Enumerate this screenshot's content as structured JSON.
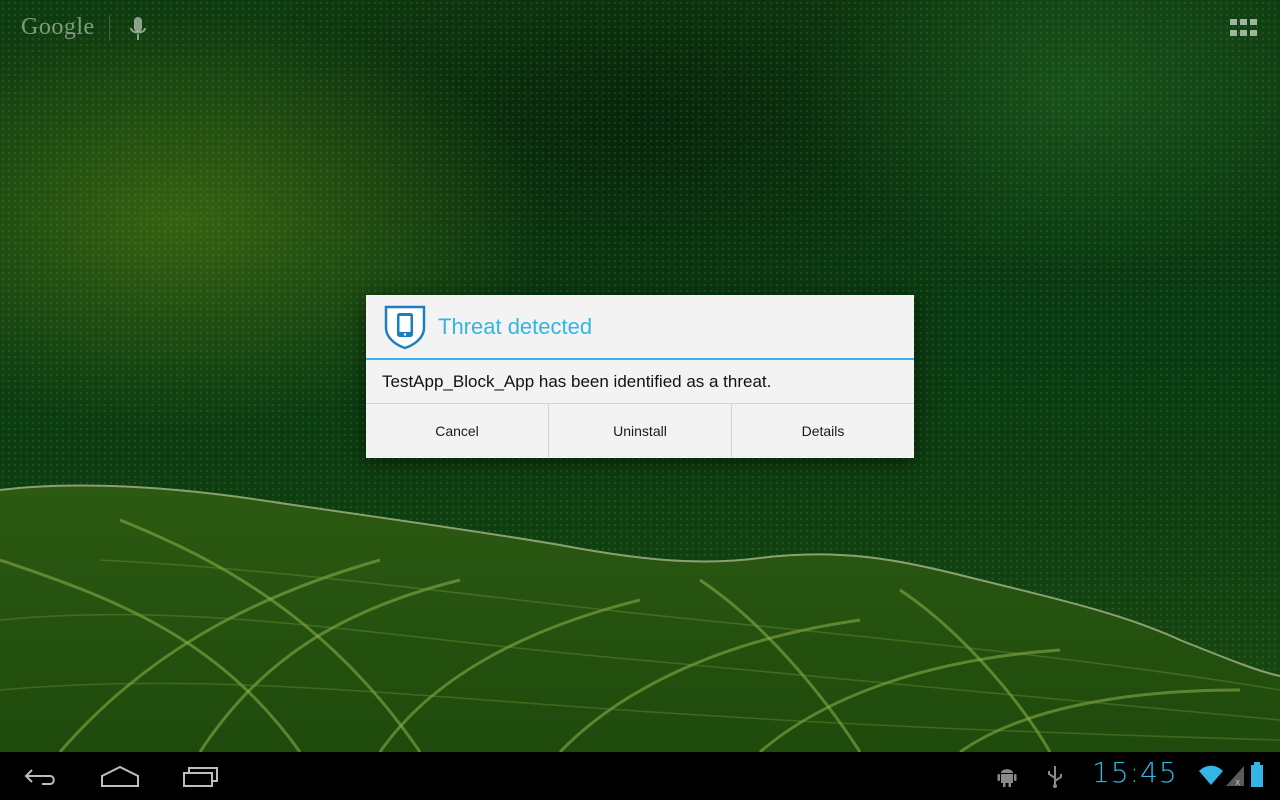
{
  "home_screen": {
    "search_logo": "Google",
    "mic_icon": "mic-icon",
    "apps_icon": "apps-grid-icon"
  },
  "dialog": {
    "icon": "shield-phone-icon",
    "title": "Threat detected",
    "message": "TestApp_Block_App has been identified as a threat.",
    "buttons": {
      "cancel": "Cancel",
      "uninstall": "Uninstall",
      "details": "Details"
    },
    "accent_color": "#33b5e5"
  },
  "system_bar": {
    "nav_icons": [
      "back-icon",
      "home-icon",
      "recent-apps-icon"
    ],
    "status_icons": [
      "android-debug-icon",
      "usb-icon",
      "wifi-icon",
      "cell-signal-icon",
      "battery-icon"
    ],
    "clock": "15:45"
  }
}
